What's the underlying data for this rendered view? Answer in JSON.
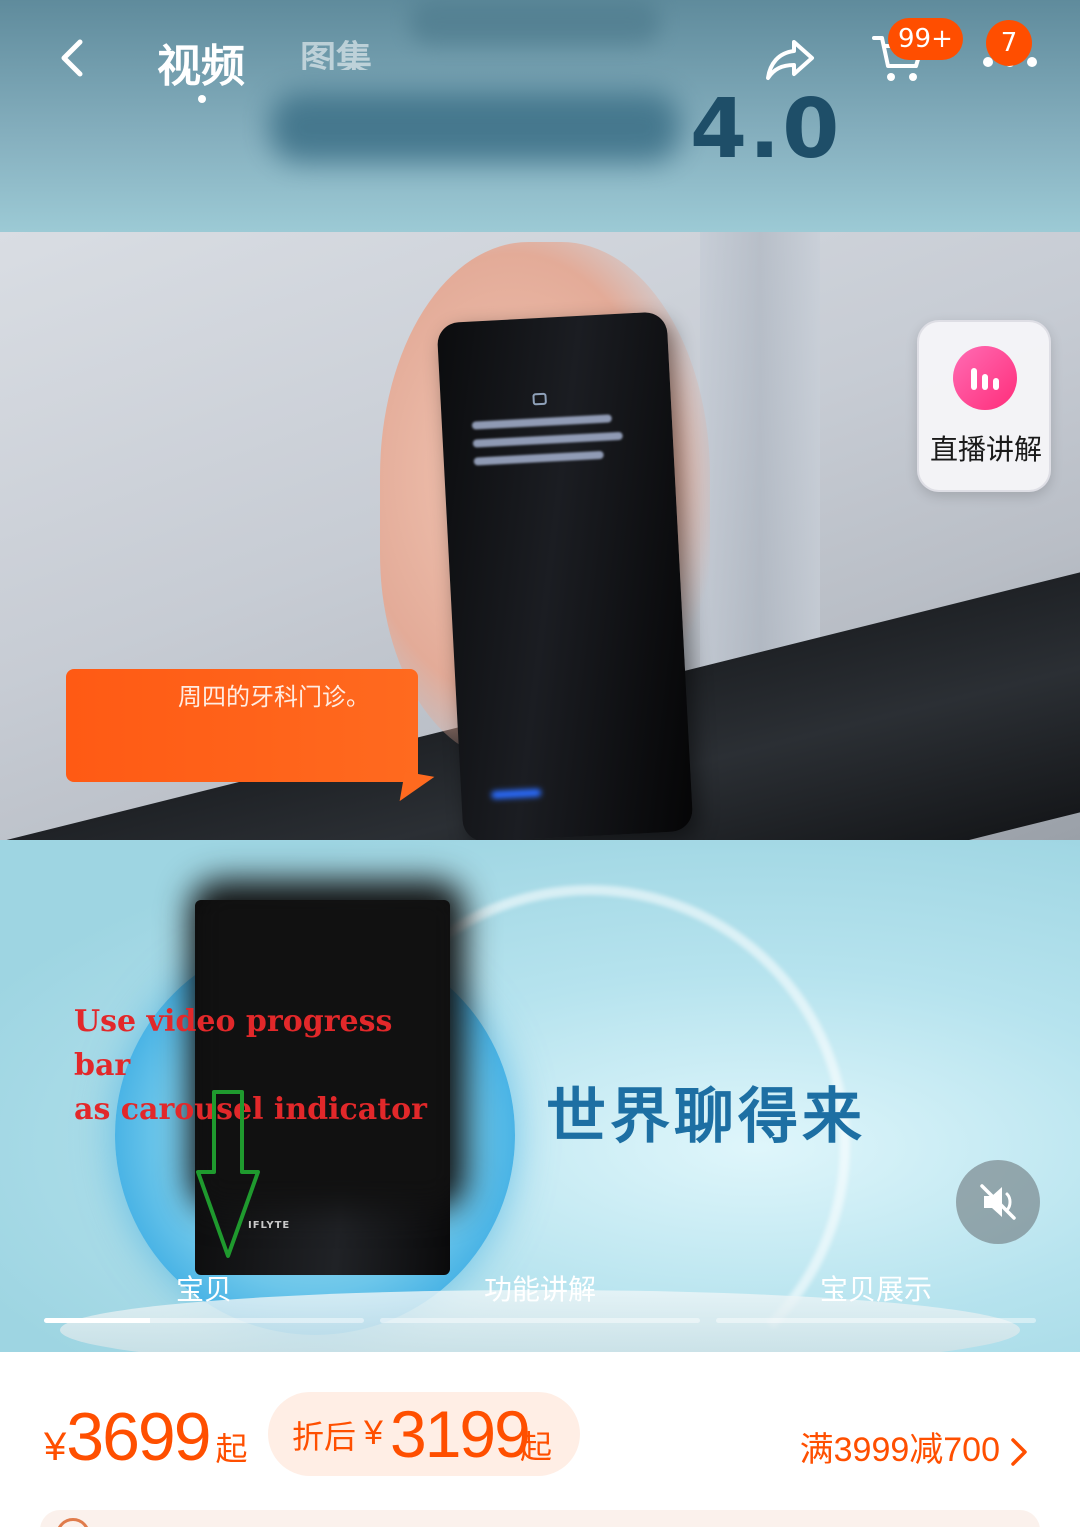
{
  "header": {
    "tabs": [
      {
        "label": "视频",
        "active": true
      },
      {
        "label": "图集",
        "active": false
      }
    ],
    "cart_badge": "99+",
    "more_badge": "7",
    "icons": {
      "back": "chevron-left-icon",
      "share": "share-arrow-icon",
      "cart": "shopping-cart-icon",
      "more": "more-dots-icon"
    }
  },
  "media": {
    "version_text": "4.0",
    "video_caption": "周四的牙科门诊。",
    "slogan": "世界聊得来",
    "device_brand": "IFLYTE",
    "live_card": {
      "label": "直播讲解",
      "icon": "live-broadcast-icon"
    },
    "mute_icon": "mute-speaker-icon"
  },
  "annotation": {
    "line1": "Use video progress bar",
    "line2": "as carousel indicator",
    "color": "#e2282a",
    "arrow_color": "#1f9a2e"
  },
  "carousel": {
    "segments": [
      {
        "label": "宝贝",
        "progress": 0.33
      },
      {
        "label": "功能讲解",
        "progress": 0
      },
      {
        "label": "宝贝展示",
        "progress": 0
      }
    ]
  },
  "price": {
    "currency": "¥",
    "original": "3699",
    "original_suffix": "起",
    "discount_label": "折后",
    "discount_price": "3199",
    "discount_suffix": "起",
    "coupon_text": "满3999减700",
    "accent_color": "#ff4f00"
  }
}
